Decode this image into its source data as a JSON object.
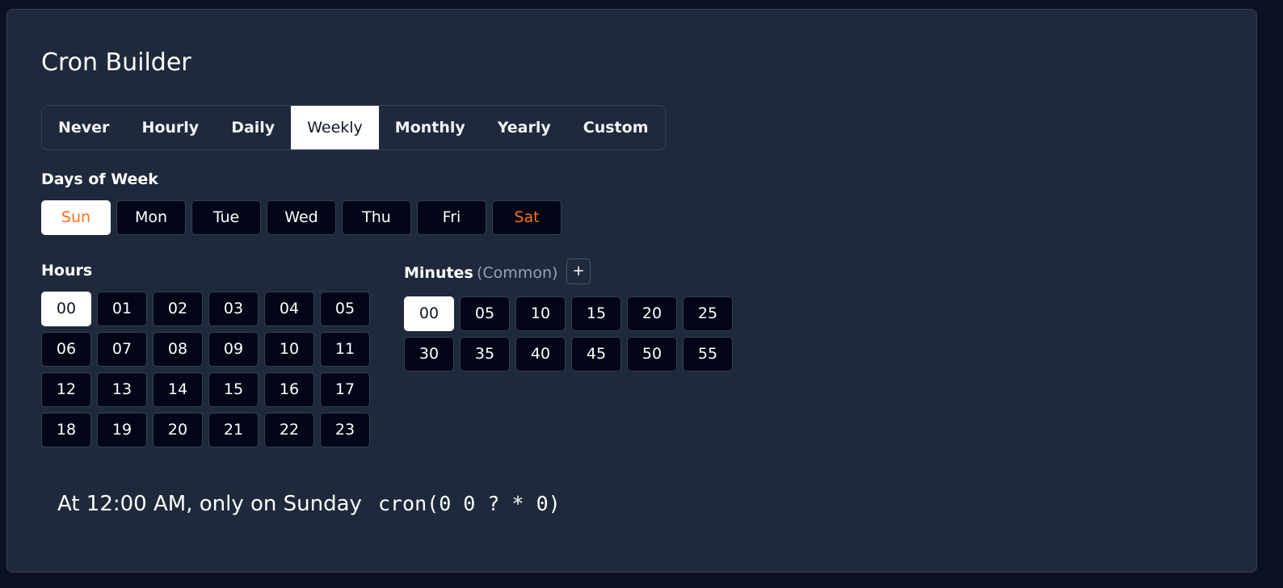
{
  "title": "Cron Builder",
  "tabs": [
    {
      "label": "Never",
      "active": false
    },
    {
      "label": "Hourly",
      "active": false
    },
    {
      "label": "Daily",
      "active": false
    },
    {
      "label": "Weekly",
      "active": true
    },
    {
      "label": "Monthly",
      "active": false
    },
    {
      "label": "Yearly",
      "active": false
    },
    {
      "label": "Custom",
      "active": false
    }
  ],
  "days_of_week": {
    "label": "Days of Week",
    "items": [
      {
        "label": "Sun",
        "selected": true,
        "weekend": true
      },
      {
        "label": "Mon",
        "selected": false,
        "weekend": false
      },
      {
        "label": "Tue",
        "selected": false,
        "weekend": false
      },
      {
        "label": "Wed",
        "selected": false,
        "weekend": false
      },
      {
        "label": "Thu",
        "selected": false,
        "weekend": false
      },
      {
        "label": "Fri",
        "selected": false,
        "weekend": false
      },
      {
        "label": "Sat",
        "selected": false,
        "weekend": true
      }
    ]
  },
  "hours": {
    "label": "Hours",
    "items": [
      "00",
      "01",
      "02",
      "03",
      "04",
      "05",
      "06",
      "07",
      "08",
      "09",
      "10",
      "11",
      "12",
      "13",
      "14",
      "15",
      "16",
      "17",
      "18",
      "19",
      "20",
      "21",
      "22",
      "23"
    ],
    "selected": [
      "00"
    ]
  },
  "minutes": {
    "label": "Minutes",
    "sublabel": "(Common)",
    "add_label": "+",
    "items": [
      "00",
      "05",
      "10",
      "15",
      "20",
      "25",
      "30",
      "35",
      "40",
      "45",
      "50",
      "55"
    ],
    "selected": [
      "00"
    ]
  },
  "summary": {
    "text": "At 12:00 AM, only on Sunday",
    "expression": "cron(0 0 ? * 0)"
  },
  "colors": {
    "background": "#0b1120",
    "card": "#1e293b",
    "button": "#020617",
    "weekend_text": "#f97316",
    "muted_text": "#94a3b8"
  }
}
